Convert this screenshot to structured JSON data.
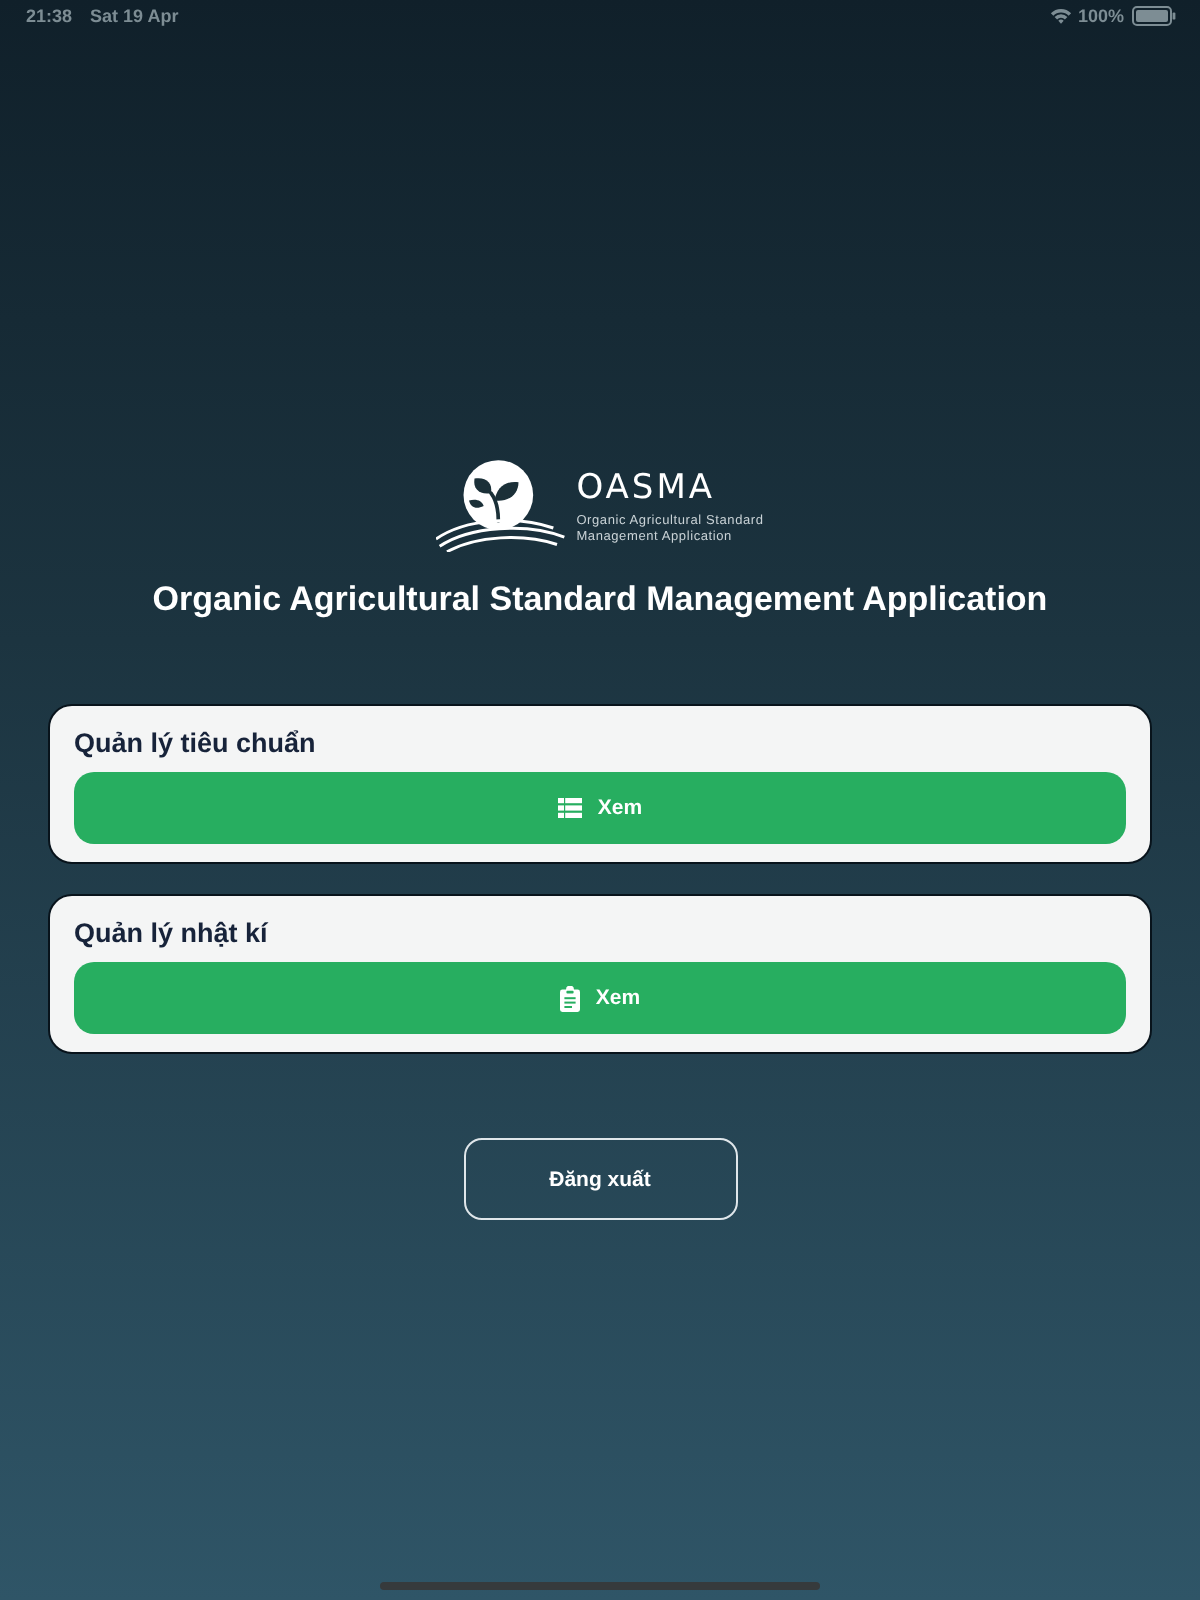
{
  "status_bar": {
    "time": "21:38",
    "date": "Sat 19 Apr",
    "battery": "100%"
  },
  "logo": {
    "name": "OASMA",
    "tagline_lines": [
      "Organic Agricultural Standard",
      "Management Application"
    ]
  },
  "title": "Organic Agricultural Standard Management Application",
  "cards": [
    {
      "title": "Quản lý tiêu chuẩn",
      "kind": "list",
      "button": {
        "label": "Xem"
      }
    },
    {
      "title": "Quản lý nhật kí",
      "kind": "clipboard",
      "button": {
        "label": "Xem"
      }
    }
  ],
  "logout_button": {
    "label": "Đăng xuất"
  }
}
